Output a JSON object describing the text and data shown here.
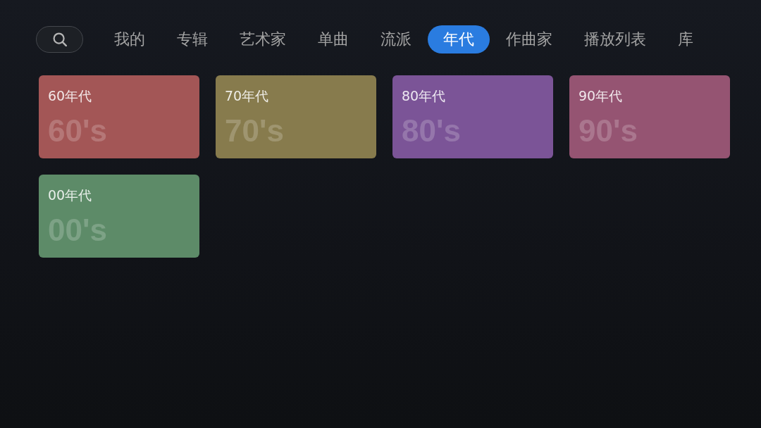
{
  "tabs": [
    {
      "label": "我的",
      "selected": false
    },
    {
      "label": "专辑",
      "selected": false
    },
    {
      "label": "艺术家",
      "selected": false
    },
    {
      "label": "单曲",
      "selected": false
    },
    {
      "label": "流派",
      "selected": false
    },
    {
      "label": "年代",
      "selected": true
    },
    {
      "label": "作曲家",
      "selected": false
    },
    {
      "label": "播放列表",
      "selected": false
    },
    {
      "label": "库",
      "selected": false
    }
  ],
  "cards": [
    {
      "title": "60年代",
      "decade_mark": "60's",
      "color": "#a35656"
    },
    {
      "title": "70年代",
      "decade_mark": "70's",
      "color": "#877b4d"
    },
    {
      "title": "80年代",
      "decade_mark": "80's",
      "color": "#7b5497"
    },
    {
      "title": "90年代",
      "decade_mark": "90's",
      "color": "#955472"
    },
    {
      "title": "00年代",
      "decade_mark": "00's",
      "color": "#5d8b68"
    }
  ]
}
